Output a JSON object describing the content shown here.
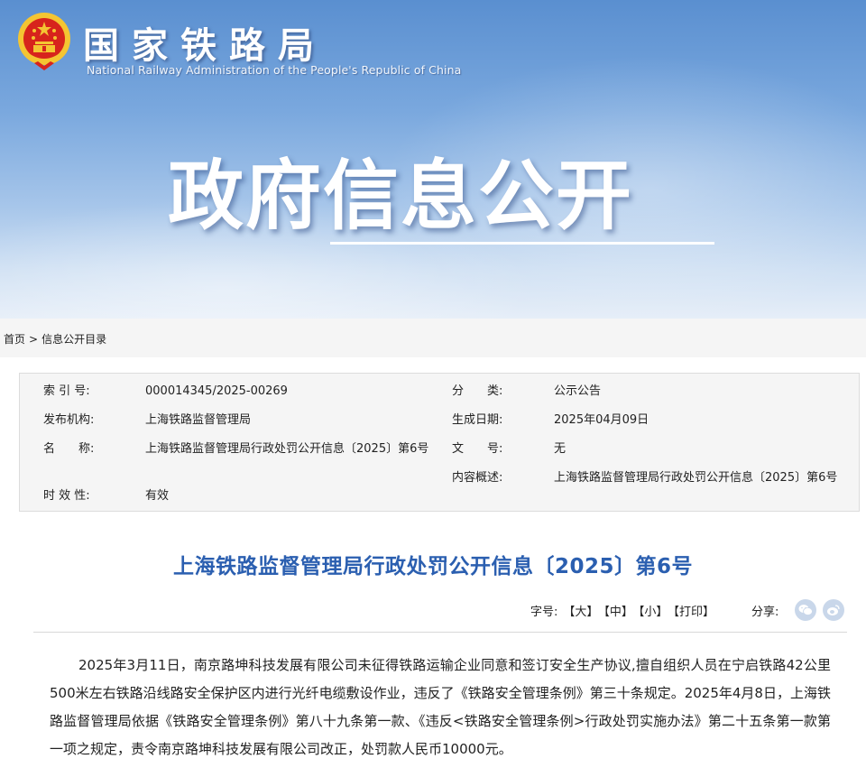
{
  "header": {
    "org_name": "国家铁路局",
    "org_name_en": "National Railway Administration of the People's Republic of China",
    "banner_title": "政府信息公开"
  },
  "breadcrumb": {
    "home": "首页",
    "separator": ">",
    "current": "信息公开目录"
  },
  "info": {
    "index_label": "索 引 号:",
    "index_value": "000014345/2025-00269",
    "category_label": "分　　类:",
    "category_value": "公示公告",
    "publisher_label": "发布机构:",
    "publisher_value": "上海铁路监督管理局",
    "date_label": "生成日期:",
    "date_value": "2025年04月09日",
    "name_label": "名　　称:",
    "name_value": "上海铁路监督管理局行政处罚公开信息〔2025〕第6号",
    "docno_label": "文　　号:",
    "docno_value": "无",
    "summary_label": "内容概述:",
    "summary_value": "上海铁路监督管理局行政处罚公开信息〔2025〕第6号",
    "validity_label": "时 效 性:",
    "validity_value": "有效"
  },
  "article": {
    "title": "上海铁路监督管理局行政处罚公开信息〔2025〕第6号",
    "body": "2025年3月11日，南京路坤科技发展有限公司未征得铁路运输企业同意和签订安全生产协议,擅自组织人员在宁启铁路42公里500米左右铁路沿线路安全保护区内进行光纤电缆敷设作业，违反了《铁路安全管理条例》第三十条规定。2025年4月8日，上海铁路监督管理局依据《铁路安全管理条例》第八十九条第一款、《违反<铁路安全管理条例>行政处罚实施办法》第二十五条第一款第一项之规定，责令南京路坤科技发展有限公司改正，处罚款人民币10000元。"
  },
  "tools": {
    "font_label": "字号:",
    "large": "【大】",
    "medium": "【中】",
    "small": "【小】",
    "print": "【打印】",
    "share_label": "分享:"
  },
  "icons": {
    "emblem": "national-emblem-icon",
    "wechat": "wechat-icon",
    "weibo": "weibo-icon"
  },
  "colors": {
    "title_blue": "#2b5fb0",
    "share_icon_bg": "#c9d7ea",
    "emblem_red": "#d7241c",
    "emblem_gold": "#f4c532"
  }
}
